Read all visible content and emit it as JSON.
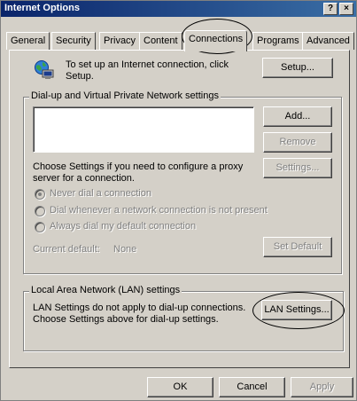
{
  "window": {
    "title": "Internet Options",
    "help_label": "?",
    "close_label": "×"
  },
  "tabs": [
    {
      "label": "General"
    },
    {
      "label": "Security"
    },
    {
      "label": "Privacy"
    },
    {
      "label": "Content"
    },
    {
      "label": "Connections",
      "active": true
    },
    {
      "label": "Programs"
    },
    {
      "label": "Advanced"
    }
  ],
  "setup_section": {
    "description": "To set up an Internet connection, click Setup.",
    "setup_button": "Setup...",
    "icon": "globe-computer-icon"
  },
  "dialup": {
    "group_label": "Dial-up and Virtual Private Network settings",
    "add_button": "Add...",
    "remove_button": "Remove",
    "settings_button": "Settings...",
    "configure_text": "Choose Settings if you need to configure a proxy server for a connection.",
    "options": [
      {
        "label": "Never dial a connection",
        "checked": true
      },
      {
        "label": "Dial whenever a network connection is not present",
        "checked": false
      },
      {
        "label": "Always dial my default connection",
        "checked": false
      }
    ],
    "current_default_label": "Current default:",
    "current_default_value": "None",
    "set_default_button": "Set Default"
  },
  "lan": {
    "group_label": "Local Area Network (LAN) settings",
    "description": "LAN Settings do not apply to dial-up connections. Choose Settings above for dial-up settings.",
    "lan_settings_button": "LAN Settings..."
  },
  "footer": {
    "ok_button": "OK",
    "cancel_button": "Cancel",
    "apply_button": "Apply"
  }
}
